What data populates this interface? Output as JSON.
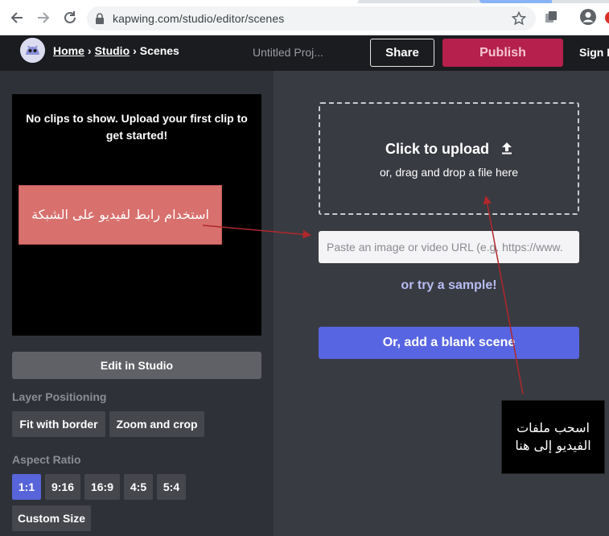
{
  "browser": {
    "url": "kapwing.com/studio/editor/scenes"
  },
  "header": {
    "breadcrumb_home": "Home",
    "breadcrumb_studio": "Studio",
    "breadcrumb_current": "Scenes",
    "breadcrumb_sep": "›",
    "project_title": "Untitled Proj...",
    "share_label": "Share",
    "publish_label": "Publish",
    "signin_label": "Sign In"
  },
  "left": {
    "preview_message": "No clips to show. Upload your first clip to get started!",
    "edit_studio_label": "Edit in Studio",
    "layer_positioning_label": "Layer Positioning",
    "layer_options": [
      "Fit with border",
      "Zoom and crop"
    ],
    "aspect_ratio_label": "Aspect Ratio",
    "aspect_options": [
      "1:1",
      "9:16",
      "16:9",
      "4:5",
      "5:4"
    ],
    "aspect_selected": "1:1",
    "custom_size_label": "Custom Size"
  },
  "right": {
    "upload_title": "Click to upload",
    "upload_sub": "or, drag and drop a file here",
    "url_placeholder": "Paste an image or video URL (e.g. https://www.",
    "sample_link": "or try a sample!",
    "blank_scene_label": "Or, add a blank scene"
  },
  "annotations": {
    "url_note": "استخدام رابط لفيديو على الشبكة",
    "drag_note": "اسحب ملفات الفيديو إلى هنا"
  },
  "colors": {
    "accent": "#5865e2",
    "publish": "#b5204c",
    "annotation_red": "#d8706e",
    "arrow": "#b0282c"
  },
  "icons": [
    "back-arrow-icon",
    "forward-arrow-icon",
    "reload-icon",
    "lock-icon",
    "star-icon",
    "extension-icon",
    "account-icon",
    "upload-icon"
  ]
}
